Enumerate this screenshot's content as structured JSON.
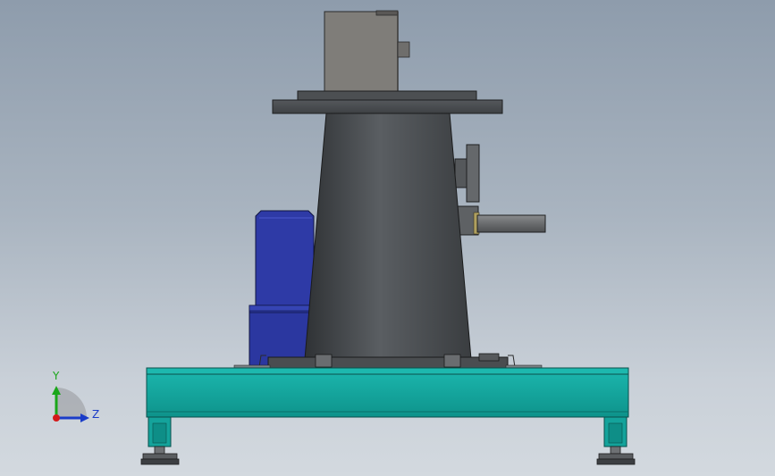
{
  "viewport": {
    "background_top": "#8e9cac",
    "background_bottom": "#d3d9df"
  },
  "model": {
    "parts": [
      "gearbox",
      "gearbox-shaft-stub",
      "mounting-flange",
      "conical-housing",
      "handwheel",
      "side-shaft",
      "electric-motor",
      "base-frame",
      "leveling-feet"
    ],
    "colors": {
      "housing": "#4a4d51",
      "gearbox": "#7f7d79",
      "motor": "#2e3aa6",
      "frame": "#12a29a"
    }
  },
  "triad": {
    "icon": "coordinate-triad-icon",
    "y_label": "Y",
    "z_label": "Z",
    "y_color": "#1aa61a",
    "z_color": "#1a3cc8",
    "x_color": "#d41a1a"
  }
}
